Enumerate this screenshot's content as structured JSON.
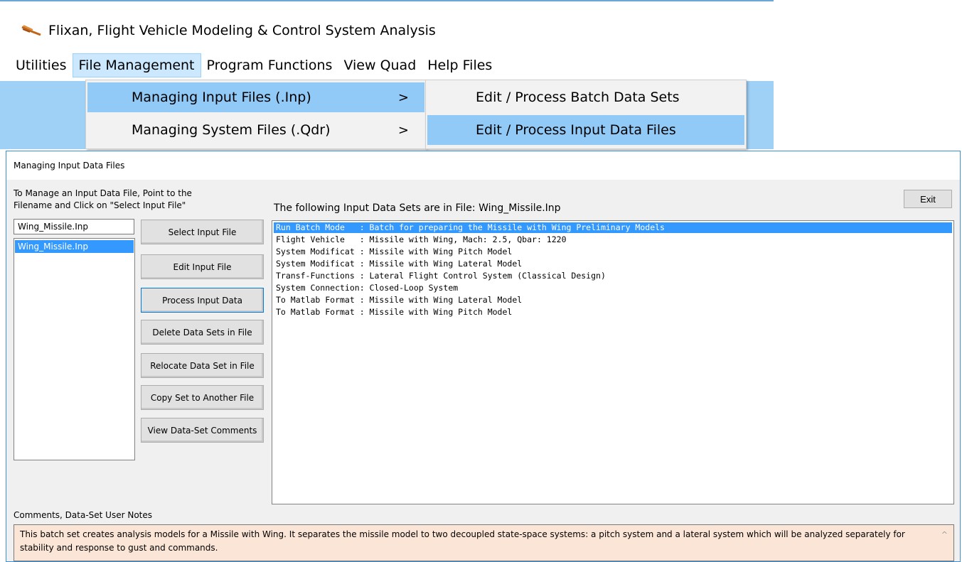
{
  "app": {
    "title": "Flixan, Flight Vehicle Modeling & Control System Analysis",
    "menu": [
      "Utilities",
      "File Management",
      "Program Functions",
      "View Quad",
      "Help Files"
    ],
    "submenu": [
      {
        "label": "Managing Input Files  (.Inp)",
        "arrow": ">"
      },
      {
        "label": "Managing System Files (.Qdr)",
        "arrow": ">"
      }
    ],
    "subsubmenu": [
      "Edit / Process Batch Data Sets",
      "Edit / Process Input Data Files"
    ]
  },
  "dialog": {
    "title": "Managing Input Data Files",
    "instruction_line1": "To Manage an Input Data File, Point to the",
    "instruction_line2": "Filename and Click on \"Select Input File\"",
    "exit_label": "Exit",
    "file_input_value": "Wing_Missile.Inp",
    "file_list": [
      "Wing_Missile.Inp"
    ],
    "buttons": [
      "Select Input File",
      "Edit Input File",
      "Process Input Data",
      "Delete Data Sets in File",
      "Relocate Data Set in File",
      "Copy Set to Another File",
      "View Data-Set Comments"
    ],
    "sets_header": "The following Input Data Sets are in File: Wing_Missile.Inp",
    "data_sets": [
      "Run Batch Mode   : Batch for preparing the Missile with Wing Preliminary Models",
      "Flight Vehicle   : Missile with Wing, Mach: 2.5, Qbar: 1220",
      "System Modificat : Missile with Wing Pitch Model",
      "System Modificat : Missile with Wing Lateral Model",
      "Transf-Functions : Lateral Flight Control System (Classical Design)",
      "System Connection: Closed-Loop System",
      "To Matlab Format : Missile with Wing Lateral Model",
      "To Matlab Format : Missile with Wing Pitch Model"
    ],
    "comments_label": "Comments, Data-Set User Notes",
    "comments_text": "This batch set creates analysis models for a Missile with Wing.  It separates the missile model to two decoupled state-space systems:  a pitch system and a lateral system which will be analyzed separately  for stability and response to gust and commands.",
    "comments_scroll_glyph": "^"
  }
}
